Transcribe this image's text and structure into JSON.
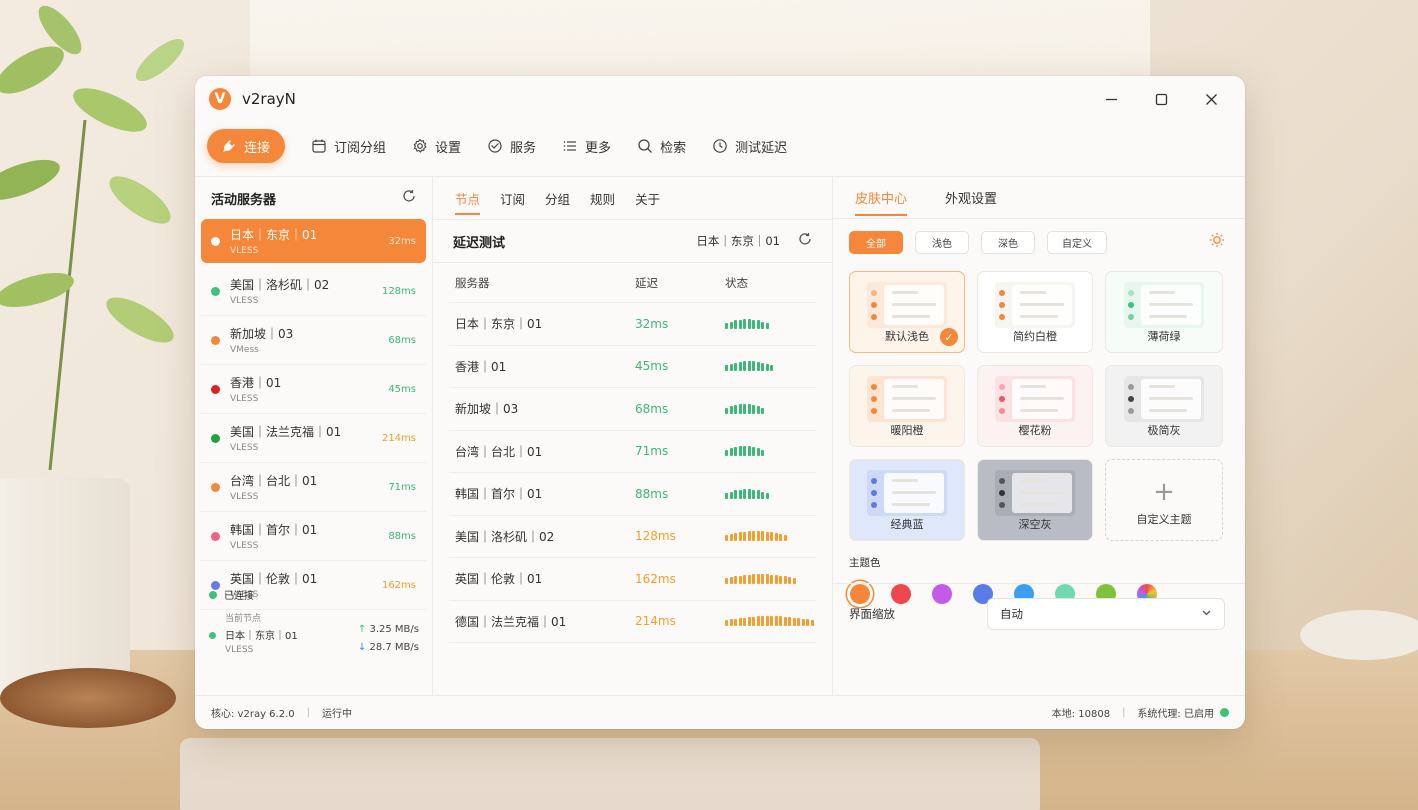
{
  "app": {
    "title": "v2rayN",
    "logo_letter": "V"
  },
  "window_controls": {
    "minimize": "—",
    "maximize": "☐",
    "close": "✕"
  },
  "toolbar": {
    "connect": "连接",
    "items": [
      {
        "label": "订阅分组",
        "icon": "calendar-icon"
      },
      {
        "label": "设置",
        "icon": "gear-icon"
      },
      {
        "label": "服务",
        "icon": "service-icon"
      },
      {
        "label": "更多",
        "icon": "list-icon"
      },
      {
        "label": "检索",
        "icon": "search-icon"
      },
      {
        "label": "测试延迟",
        "icon": "clock-icon"
      }
    ]
  },
  "left": {
    "title": "活动服务器",
    "servers": [
      {
        "name": "日本｜东京｜01",
        "protocol": "VLESS",
        "latency": "32ms",
        "dot": "#ffffff",
        "lat_color": "#ffe4cf"
      },
      {
        "name": "美国｜洛杉矶｜02",
        "protocol": "VLESS",
        "latency": "128ms",
        "dot": "#3cc27a",
        "lat_color": "#3cb878"
      },
      {
        "name": "新加坡｜03",
        "protocol": "VMess",
        "latency": "68ms",
        "dot": "#f5873a",
        "lat_color": "#3cb878"
      },
      {
        "name": "香港｜01",
        "protocol": "VLESS",
        "latency": "45ms",
        "dot": "#e02020",
        "lat_color": "#3cb878"
      },
      {
        "name": "美国｜法兰克福｜01",
        "protocol": "VLESS",
        "latency": "214ms",
        "dot": "#22a33a",
        "lat_color": "#f0a030"
      },
      {
        "name": "台湾｜台北｜01",
        "protocol": "VLESS",
        "latency": "71ms",
        "dot": "#f5873a",
        "lat_color": "#3cb878"
      },
      {
        "name": "韩国｜首尔｜01",
        "protocol": "VLESS",
        "latency": "88ms",
        "dot": "#f06080",
        "lat_color": "#3cb878"
      },
      {
        "name": "英国｜伦敦｜01",
        "protocol": "VLESS",
        "latency": "162ms",
        "dot": "#6a7be0",
        "lat_color": "#f0a030"
      }
    ],
    "connection": {
      "status": "已连接",
      "current_label": "当前节点",
      "current_name": "日本｜东京｜01",
      "current_protocol": "VLESS",
      "up": "↑ 3.25 MB/s",
      "down": "↓ 28.7 MB/s"
    }
  },
  "middle": {
    "tabs": [
      "节点",
      "订阅",
      "分组",
      "规则",
      "关于"
    ],
    "active_tab": "节点",
    "latency_title": "延迟测试",
    "selected": "日本｜东京｜01",
    "columns": [
      "服务器",
      "延迟",
      "状态"
    ],
    "rows": [
      {
        "server": "日本｜东京｜01",
        "latency": "32ms",
        "color": "#3cb878",
        "bars": 10
      },
      {
        "server": "香港｜01",
        "latency": "45ms",
        "color": "#3cb878",
        "bars": 11
      },
      {
        "server": "新加坡｜03",
        "latency": "68ms",
        "color": "#3cb878",
        "bars": 9
      },
      {
        "server": "台湾｜台北｜01",
        "latency": "71ms",
        "color": "#3cb878",
        "bars": 9
      },
      {
        "server": "韩国｜首尔｜01",
        "latency": "88ms",
        "color": "#3cb878",
        "bars": 10
      },
      {
        "server": "美国｜洛杉矶｜02",
        "latency": "128ms",
        "color": "#f0a030",
        "bars": 14
      },
      {
        "server": "英国｜伦敦｜01",
        "latency": "162ms",
        "color": "#f0a030",
        "bars": 16
      },
      {
        "server": "德国｜法兰克福｜01",
        "latency": "214ms",
        "color": "#f0a030",
        "bars": 20
      }
    ]
  },
  "right": {
    "tabs": [
      "皮肤中心",
      "外观设置"
    ],
    "filters": [
      "全部",
      "浅色",
      "深色",
      "自定义"
    ],
    "themes": [
      {
        "name": "默认浅色",
        "bg": "#fff4ea",
        "mini": "#fde9d9",
        "dots": [
          "#f5b784",
          "#f5873a",
          "#f5873a"
        ],
        "active": true
      },
      {
        "name": "简约白橙",
        "bg": "#ffffff",
        "mini": "#f7f5f2",
        "dots": [
          "#f5873a",
          "#f5873a",
          "#f5873a"
        ]
      },
      {
        "name": "薄荷绿",
        "bg": "#f6fcf8",
        "mini": "#e8f7ee",
        "dots": [
          "#a8e2c2",
          "#3cc27a",
          "#6fd59e"
        ]
      },
      {
        "name": "暖阳橙",
        "bg": "#fdf4ec",
        "mini": "#fbe4d2",
        "dots": [
          "#f5873a",
          "#f5873a",
          "#f5873a"
        ]
      },
      {
        "name": "樱花粉",
        "bg": "#fdf2f2",
        "mini": "#fbe2e2",
        "dots": [
          "#f3a8b0",
          "#e85a6a",
          "#f08c98"
        ]
      },
      {
        "name": "极简灰",
        "bg": "#f2f2f2",
        "mini": "#e6e6e6",
        "dots": [
          "#9a9a9a",
          "#444444",
          "#9a9a9a"
        ]
      },
      {
        "name": "经典蓝",
        "bg": "#dfe7fb",
        "mini": "#cdd9f7",
        "dots": [
          "#5a7be0",
          "#5a7be0",
          "#5a7be0"
        ]
      },
      {
        "name": "深空灰",
        "bg": "#b9bcc4",
        "mini": "#a9adb6",
        "dots": [
          "#555",
          "#333",
          "#555"
        ]
      }
    ],
    "add_theme": "自定义主题",
    "theme_color_label": "主题色",
    "swatches": [
      "#f5873a",
      "#f0474e",
      "#c15be8",
      "#5b7bea",
      "#3a9ff0",
      "#6ddab0",
      "#7cc23a",
      "conic"
    ],
    "scale_label": "界面缩放",
    "scale_value": "自动"
  },
  "status": {
    "core": "核心: v2ray 6.2.0",
    "running": "运行中",
    "local": "本地: 10808",
    "proxy": "系统代理: 已启用"
  }
}
